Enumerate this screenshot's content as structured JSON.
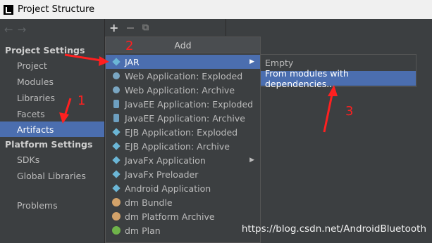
{
  "window": {
    "title": "Project Structure"
  },
  "toolbar": {
    "add": "+",
    "remove": "−",
    "copy": "⧉"
  },
  "nav": {
    "back": "←",
    "forward": "→"
  },
  "sidebar": {
    "project_settings_header": "Project Settings",
    "project_items": [
      "Project",
      "Modules",
      "Libraries",
      "Facets",
      "Artifacts"
    ],
    "platform_settings_header": "Platform Settings",
    "platform_items": [
      "SDKs",
      "Global Libraries"
    ],
    "problems": "Problems",
    "selected": "Artifacts"
  },
  "add_popup": {
    "title": "Add",
    "items": [
      {
        "label": "JAR",
        "icon": "jar-icon",
        "submenu": true
      },
      {
        "label": "Web Application: Exploded",
        "icon": "web-app-icon",
        "submenu": false
      },
      {
        "label": "Web Application: Archive",
        "icon": "web-app-icon",
        "submenu": false
      },
      {
        "label": "JavaEE Application: Exploded",
        "icon": "javaee-icon",
        "submenu": false
      },
      {
        "label": "JavaEE Application: Archive",
        "icon": "javaee-icon",
        "submenu": false
      },
      {
        "label": "EJB Application: Exploded",
        "icon": "ejb-icon",
        "submenu": false
      },
      {
        "label": "EJB Application: Archive",
        "icon": "ejb-icon",
        "submenu": false
      },
      {
        "label": "JavaFx Application",
        "icon": "javafx-icon",
        "submenu": true
      },
      {
        "label": "JavaFx Preloader",
        "icon": "javafx-icon",
        "submenu": false
      },
      {
        "label": "Android Application",
        "icon": "android-icon",
        "submenu": false
      },
      {
        "label": "dm Bundle",
        "icon": "dm-icon",
        "submenu": false
      },
      {
        "label": "dm Platform Archive",
        "icon": "dm-icon",
        "submenu": false
      },
      {
        "label": "dm Plan",
        "icon": "dm-plan-icon",
        "submenu": false
      }
    ],
    "selected": "JAR"
  },
  "jar_submenu": {
    "items": [
      "Empty",
      "From modules with dependencies..."
    ],
    "selected": "From modules with dependencies..."
  },
  "annotations": {
    "one": "1",
    "two": "2",
    "three": "3"
  },
  "watermark": "https://blog.csdn.net/AndroidBluetooth",
  "colors": {
    "selection": "#4b6eaf",
    "background": "#3c3f41",
    "annotation": "#ff2020"
  }
}
